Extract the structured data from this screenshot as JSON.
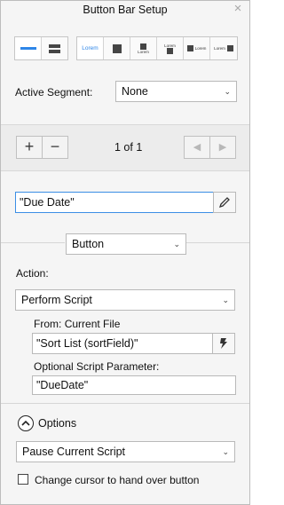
{
  "window": {
    "title": "Button Bar Setup",
    "close_glyph": "×"
  },
  "orientation_buttons": [
    {
      "name": "horizontal-orientation-icon",
      "active": true
    },
    {
      "name": "vertical-orientation-icon",
      "active": false
    }
  ],
  "icon_text": {
    "lorem": "Lorem"
  },
  "active_segment": {
    "label": "Active Segment:",
    "value": "None"
  },
  "segment_nav": {
    "add_glyph": "+",
    "remove_glyph": "−",
    "counter": "1 of 1",
    "prev_glyph": "◀",
    "next_glyph": "▶"
  },
  "segment_label": {
    "value": "\"Due Date\""
  },
  "segment_type": {
    "value": "Button"
  },
  "action": {
    "label": "Action:",
    "value": "Perform Script",
    "from_label": "From:",
    "from_value": "Current File",
    "script_value": "\"Sort List (sortField)\"",
    "param_label": "Optional Script Parameter:",
    "param_value": "\"DueDate\""
  },
  "options": {
    "label": "Options",
    "script_behavior": "Pause Current Script",
    "cursor_checkbox_label": "Change cursor to hand over button",
    "cursor_checked": false
  },
  "colors": {
    "accent": "#2e86e8",
    "focus_border": "#3b8ee5"
  }
}
